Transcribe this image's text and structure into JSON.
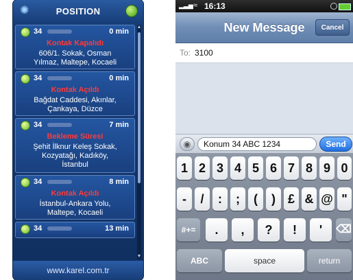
{
  "left_app": {
    "title": "POSITION",
    "footer": "www.karel.com.tr",
    "entries": [
      {
        "plate": "34",
        "time": "0 min",
        "status": "Kontak Kapalıdı",
        "address_lines": [
          "606/1. Sokak, Osman",
          "Yılmaz, Maltepe, Kocaeli"
        ]
      },
      {
        "plate": "34",
        "time": "0 min",
        "status": "Kontak Açıldı",
        "address_lines": [
          "Bağdat Caddesi, Akınlar,",
          "Çankaya, Düzce"
        ]
      },
      {
        "plate": "34",
        "time": "7 min",
        "status": "Bekleme Süresi",
        "address_lines": [
          "Şehit İlknur Keleş Sokak,",
          "Kozyatağı, Kadıköy,",
          "İstanbul"
        ]
      },
      {
        "plate": "34",
        "time": "8 min",
        "status": "Kontak Açıldı",
        "address_lines": [
          "İstanbul-Ankara Yolu,",
          "Maltepe, Kocaeli"
        ]
      },
      {
        "plate": "34",
        "time": "13 min"
      }
    ]
  },
  "sms": {
    "clock": "16:13",
    "title": "New Message",
    "cancel": "Cancel",
    "to_label": "To:",
    "to_value": "3100",
    "message": "Konum 34 ABC 1234",
    "send": "Send"
  },
  "keyboard": {
    "row1": [
      "1",
      "2",
      "3",
      "4",
      "5",
      "6",
      "7",
      "8",
      "9",
      "0"
    ],
    "row2": [
      "-",
      "/",
      ":",
      ";",
      "(",
      ")",
      "£",
      "&",
      "@",
      "\""
    ],
    "row3_left": "#+=",
    "row3": [
      ".",
      ",",
      "?",
      "!",
      "'"
    ],
    "row3_right_icon": "backspace-icon",
    "abc": "ABC",
    "space": "space",
    "return": "return"
  }
}
